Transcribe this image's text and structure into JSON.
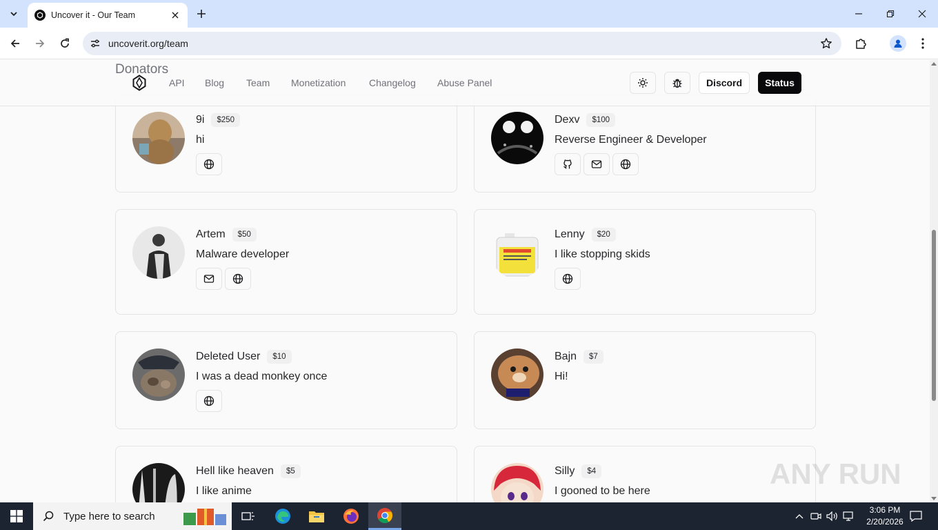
{
  "browser": {
    "tab_title": "Uncover it - Our Team",
    "url": "uncoverit.org/team"
  },
  "site": {
    "section_title": "Donators",
    "nav": [
      "API",
      "Blog",
      "Team",
      "Monetization",
      "Changelog",
      "Abuse Panel"
    ],
    "discord_label": "Discord",
    "status_label": "Status"
  },
  "donators": [
    {
      "name": "9i",
      "amount": "$250",
      "description": "hi",
      "links": [
        "globe-icon"
      ]
    },
    {
      "name": "Dexv",
      "amount": "$100",
      "description": "Reverse Engineer & Developer",
      "links": [
        "github-icon",
        "mail-icon",
        "globe-icon"
      ]
    },
    {
      "name": "Artem",
      "amount": "$50",
      "description": "Malware developer",
      "links": [
        "mail-icon",
        "globe-icon"
      ]
    },
    {
      "name": "Lenny",
      "amount": "$20",
      "description": "I like stopping skids",
      "links": [
        "globe-icon"
      ]
    },
    {
      "name": "Deleted User",
      "amount": "$10",
      "description": "I was a dead monkey once",
      "links": [
        "globe-icon"
      ]
    },
    {
      "name": "Bajn",
      "amount": "$7",
      "description": "Hi!",
      "links": []
    },
    {
      "name": "Hell like heaven",
      "amount": "$5",
      "description": "I like anime",
      "links": []
    },
    {
      "name": "Silly",
      "amount": "$4",
      "description": "I gooned to be here",
      "links": []
    }
  ],
  "watermark": "ANY RUN",
  "taskbar": {
    "search_placeholder": "Type here to search",
    "time": "3:06 PM",
    "date": "2/20/2026"
  }
}
